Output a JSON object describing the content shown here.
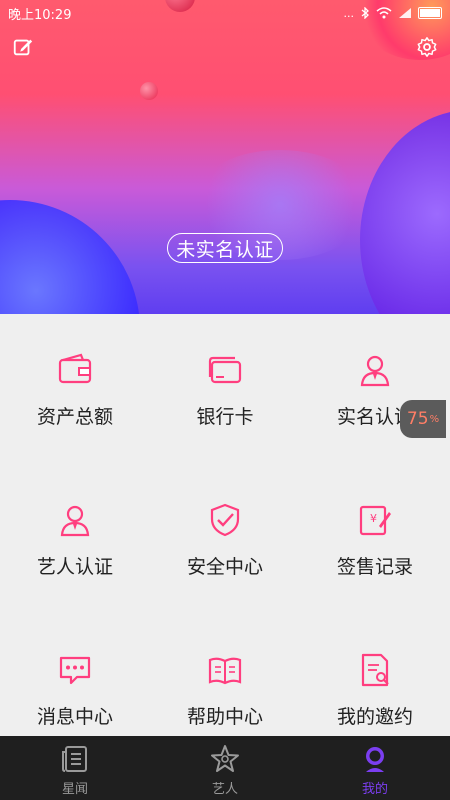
{
  "status": {
    "time": "晚上10:29",
    "dots": "..."
  },
  "hero": {
    "verify_label": "未实名认证"
  },
  "grid": [
    {
      "label": "资产总额",
      "icon": "wallet-icon"
    },
    {
      "label": "银行卡",
      "icon": "card-icon"
    },
    {
      "label": "实名认证",
      "icon": "person-icon"
    },
    {
      "label": "艺人认证",
      "icon": "artist-icon"
    },
    {
      "label": "安全中心",
      "icon": "shield-icon"
    },
    {
      "label": "签售记录",
      "icon": "record-icon"
    },
    {
      "label": "消息中心",
      "icon": "message-icon"
    },
    {
      "label": "帮助中心",
      "icon": "book-icon"
    },
    {
      "label": "我的邀约",
      "icon": "invite-icon"
    }
  ],
  "float_badge": {
    "value": "75",
    "unit": "%"
  },
  "tabs": [
    {
      "label": "星闻",
      "icon": "news-icon",
      "active": false
    },
    {
      "label": "艺人",
      "icon": "star-icon",
      "active": false
    },
    {
      "label": "我的",
      "icon": "profile-icon",
      "active": true
    }
  ],
  "colors": {
    "accent": "#ff3e7f",
    "active_tab": "#7b3ef0",
    "tabbar_bg": "#1f1f1f"
  }
}
